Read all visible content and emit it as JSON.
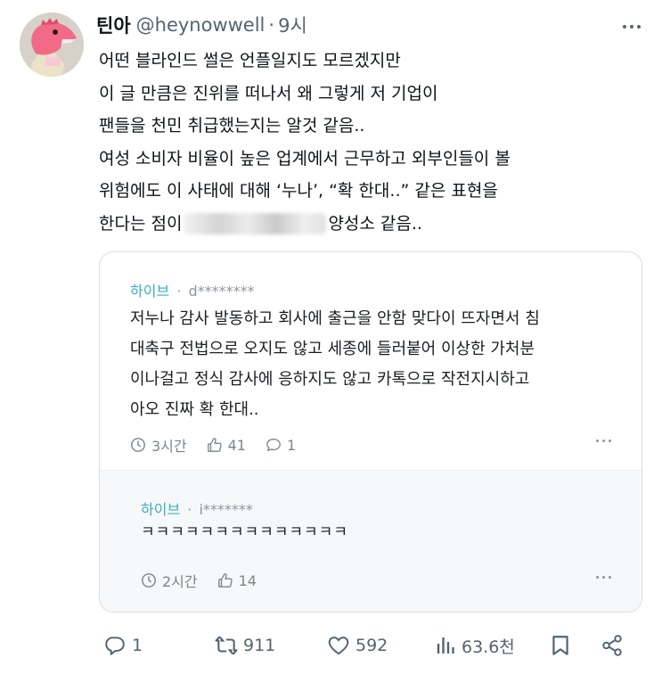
{
  "tweet": {
    "author_name": "틴아",
    "handle": "@heynowwell",
    "separator": "·",
    "time": "9시",
    "avatar": "pink-dinosaur-avatar",
    "lines": [
      "어떤 블라인드 썰은 언플일지도 모르겠지만",
      "이 글 만큼은 진위를 떠나서 왜 그렇게 저 기업이",
      "팬들을 천민 취급했는지는 알것 같음..",
      "여성 소비자 비율이 높은 업계에서 근무하고 외부인들이 볼",
      "위험에도 이 사태에 대해 ‘누나’, “확 한대..” 같은 표현을"
    ],
    "last_line_start": "한다는 점이",
    "last_line_end": "양성소 같음..",
    "more_icon": "more-horizontal-icon"
  },
  "quoted": {
    "comment": {
      "brand": "하이브",
      "separator": "·",
      "user": "d********",
      "lines": [
        "저누나 감사 발동하고 회사에 출근을 안함 맞다이 뜨자면서 침",
        "대축구 전법으로 오지도 않고 세종에 들러붙어 이상한 가처분",
        "이나걸고 정식 감사에 응하지도 않고 카톡으로 작전지시하고",
        "아오 진짜 확 한대.."
      ],
      "time": "3시간",
      "likes": "41",
      "replies": "1"
    },
    "reply": {
      "brand": "하이브",
      "separator": "·",
      "user": "i*******",
      "text": "ㅋㅋㅋㅋㅋㅋㅋㅋㅋㅋㅋㅋㅋㅋ",
      "time": "2시간",
      "likes": "14"
    }
  },
  "actions": {
    "reply_count": "1",
    "retweet_count": "911",
    "like_count": "592",
    "view_count": "63.6천"
  },
  "colors": {
    "brand_teal": "#3aaec2",
    "muted_gray": "#536471",
    "text_dark": "#0f1419"
  }
}
